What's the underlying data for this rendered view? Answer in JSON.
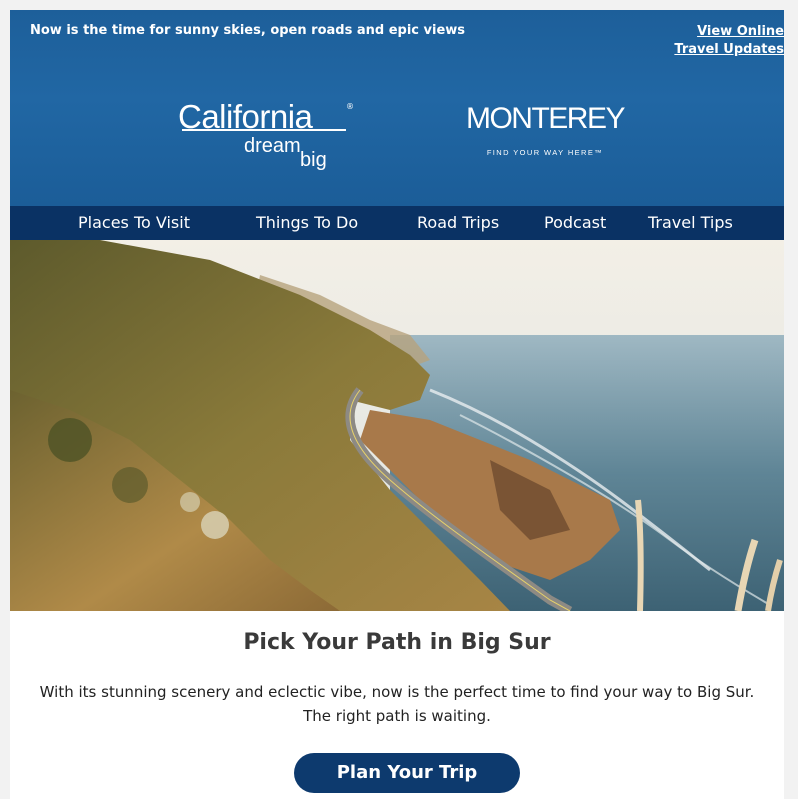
{
  "header": {
    "tagline": "Now is the time for sunny skies, open roads and epic views",
    "links": {
      "view_online": "View Online",
      "travel_updates": "Travel Updates"
    },
    "background_color": "#1f63a0"
  },
  "logos": {
    "california": {
      "word": "California",
      "registered": "®",
      "dream": "dream",
      "big": "big"
    },
    "monterey": {
      "word": "MONTEREY",
      "tagline": "FIND YOUR WAY HERE™"
    }
  },
  "nav": {
    "background_color": "#0a3264",
    "items": [
      {
        "label": "Places To Visit"
      },
      {
        "label": "Things To Do"
      },
      {
        "label": "Road Trips"
      },
      {
        "label": "Podcast"
      },
      {
        "label": "Travel Tips"
      }
    ]
  },
  "hero": {
    "icon": "big-sur-coastline-photo"
  },
  "content": {
    "title": "Pick Your Path in Big Sur",
    "body": "With its stunning scenery and eclectic vibe, now is the perfect time to find your way to Big Sur. The right path is waiting.",
    "cta_label": "Plan Your Trip",
    "cta_color": "#0d3a6e"
  }
}
